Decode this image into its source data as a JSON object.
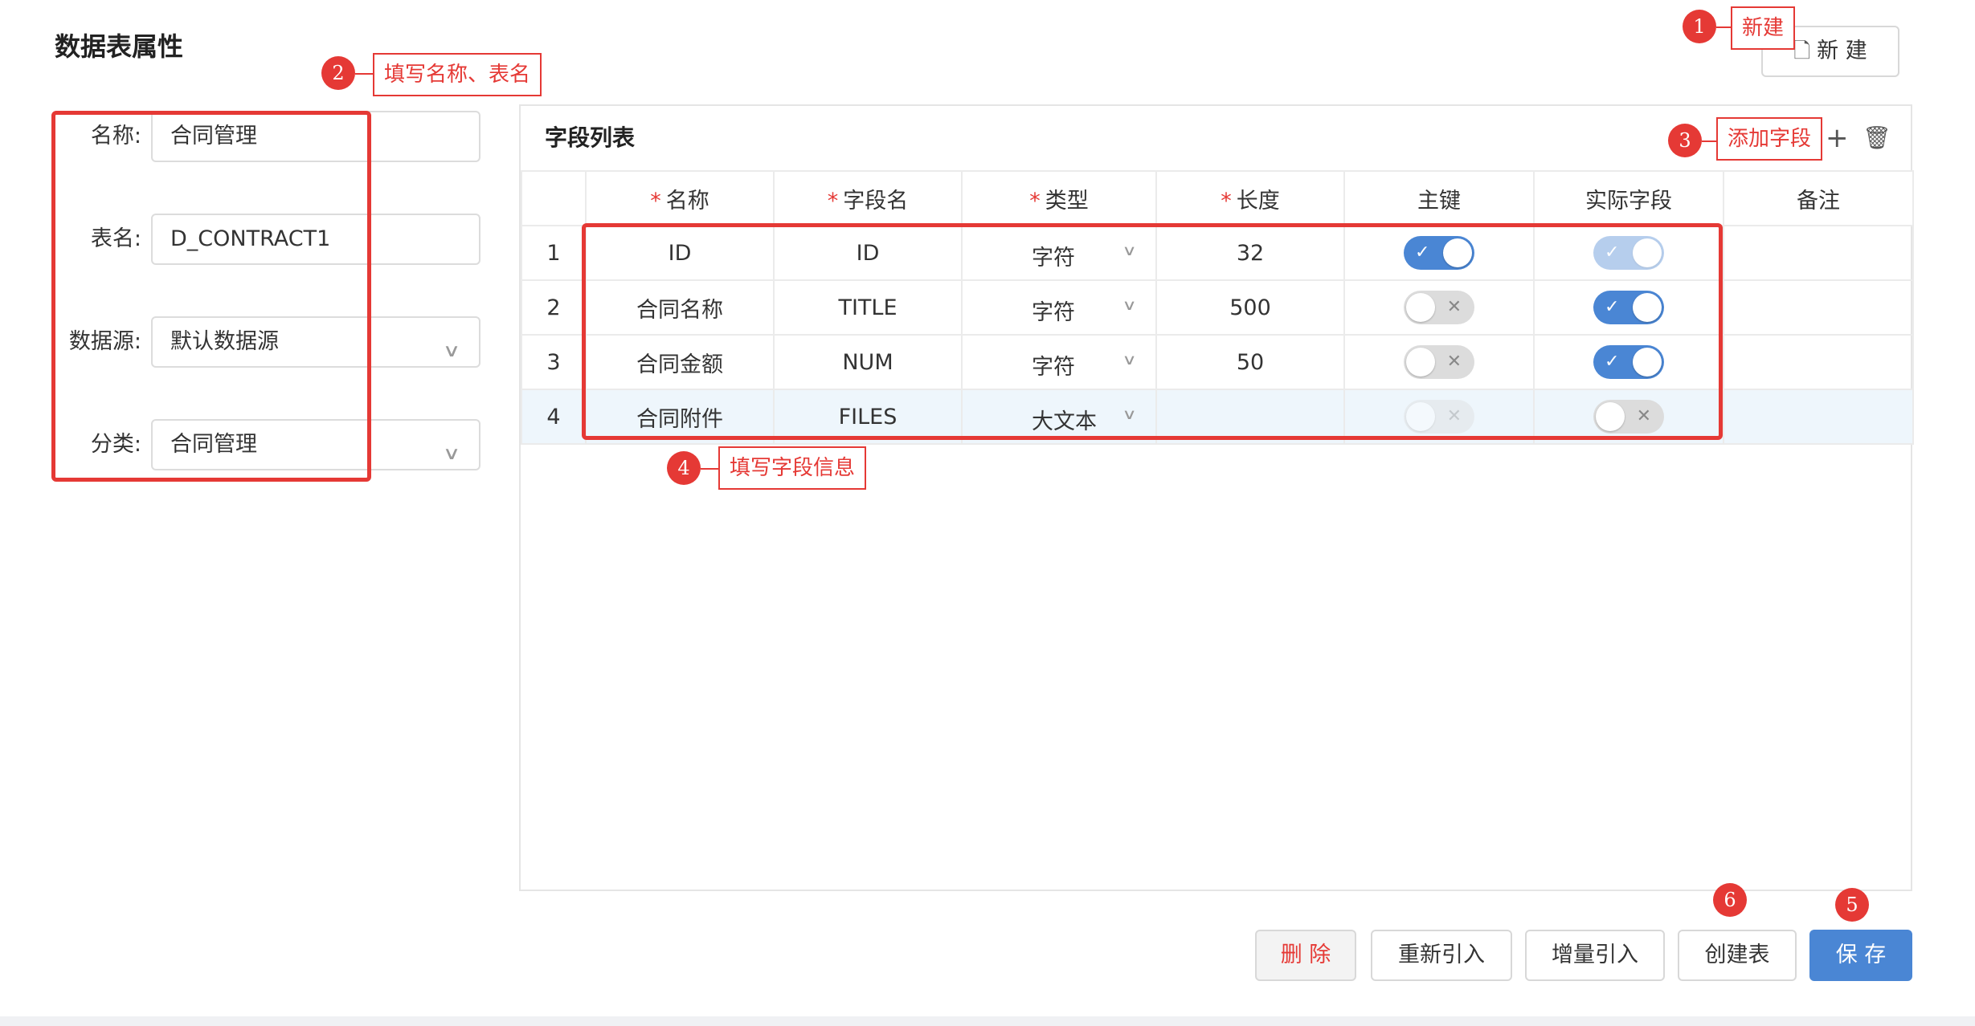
{
  "page": {
    "title": "数据表属性"
  },
  "toolbar": {
    "new_label": "新 建"
  },
  "form": {
    "name": {
      "label": "名称:",
      "value": "合同管理"
    },
    "table": {
      "label": "表名:",
      "value": "D_CONTRACT1"
    },
    "source": {
      "label": "数据源:",
      "value": "默认数据源"
    },
    "category": {
      "label": "分类:",
      "value": "合同管理"
    }
  },
  "field_panel": {
    "title": "字段列表",
    "columns": [
      "名称",
      "字段名",
      "类型",
      "长度",
      "主键",
      "实际字段",
      "备注"
    ],
    "required_marker": "*",
    "rows": [
      {
        "num": "1",
        "name": "ID",
        "field": "ID",
        "type": "字符",
        "length": "32",
        "primary_key": true,
        "pk_disabled": false,
        "actual": true,
        "actual_disabled": true,
        "remark": ""
      },
      {
        "num": "2",
        "name": "合同名称",
        "field": "TITLE",
        "type": "字符",
        "length": "500",
        "primary_key": false,
        "pk_disabled": false,
        "actual": true,
        "actual_disabled": false,
        "remark": ""
      },
      {
        "num": "3",
        "name": "合同金额",
        "field": "NUM",
        "type": "字符",
        "length": "50",
        "primary_key": false,
        "pk_disabled": false,
        "actual": true,
        "actual_disabled": false,
        "remark": ""
      },
      {
        "num": "4",
        "name": "合同附件",
        "field": "FILES",
        "type": "大文本",
        "length": "",
        "primary_key": false,
        "pk_disabled": true,
        "actual": false,
        "actual_disabled": false,
        "remark": ""
      }
    ],
    "add_icon": "plus-icon",
    "delete_icon": "trash-icon"
  },
  "actions": {
    "delete": "删 除",
    "reimport": "重新引入",
    "incremental_import": "增量引入",
    "create_table": "创建表",
    "save": "保 存"
  },
  "annotations": {
    "a1": {
      "num": "1",
      "label": "新建"
    },
    "a2": {
      "num": "2",
      "label": "填写名称、表名"
    },
    "a3": {
      "num": "3",
      "label": "添加字段"
    },
    "a4": {
      "num": "4",
      "label": "填写字段信息"
    },
    "a5": {
      "num": "5"
    },
    "a6": {
      "num": "6"
    }
  },
  "colors": {
    "accent": "#4a86d4",
    "annotation": "#e53935",
    "danger_text": "#e53935"
  }
}
